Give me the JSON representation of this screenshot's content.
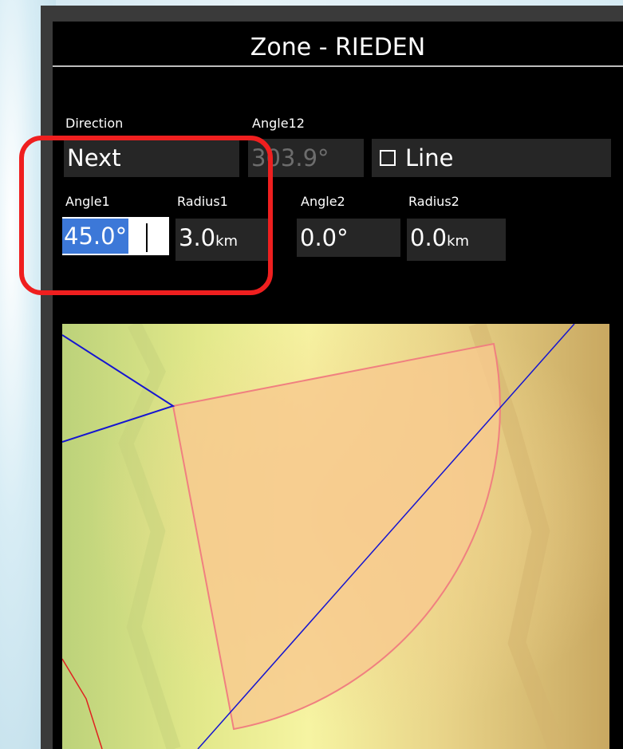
{
  "dialog": {
    "title": "Zone - RIEDEN"
  },
  "fields": {
    "direction": {
      "label": "Direction",
      "value": "Next"
    },
    "angle12": {
      "label": "Angle12",
      "value": "303.9°"
    },
    "line": {
      "label": "Line",
      "checked": false
    },
    "angle1": {
      "label": "Angle1",
      "value": "45.0°"
    },
    "radius1": {
      "label": "Radius1",
      "value": "3.0",
      "unit": "km"
    },
    "angle2": {
      "label": "Angle2",
      "value": "0.0°"
    },
    "radius2": {
      "label": "Radius2",
      "value": "0.0",
      "unit": "km"
    }
  },
  "colors": {
    "highlight": "#ef1f1f",
    "selection": "#3c78d8",
    "sector_fill": "#f7c98e",
    "sector_stroke": "#f08080",
    "track": "#1515d0"
  }
}
